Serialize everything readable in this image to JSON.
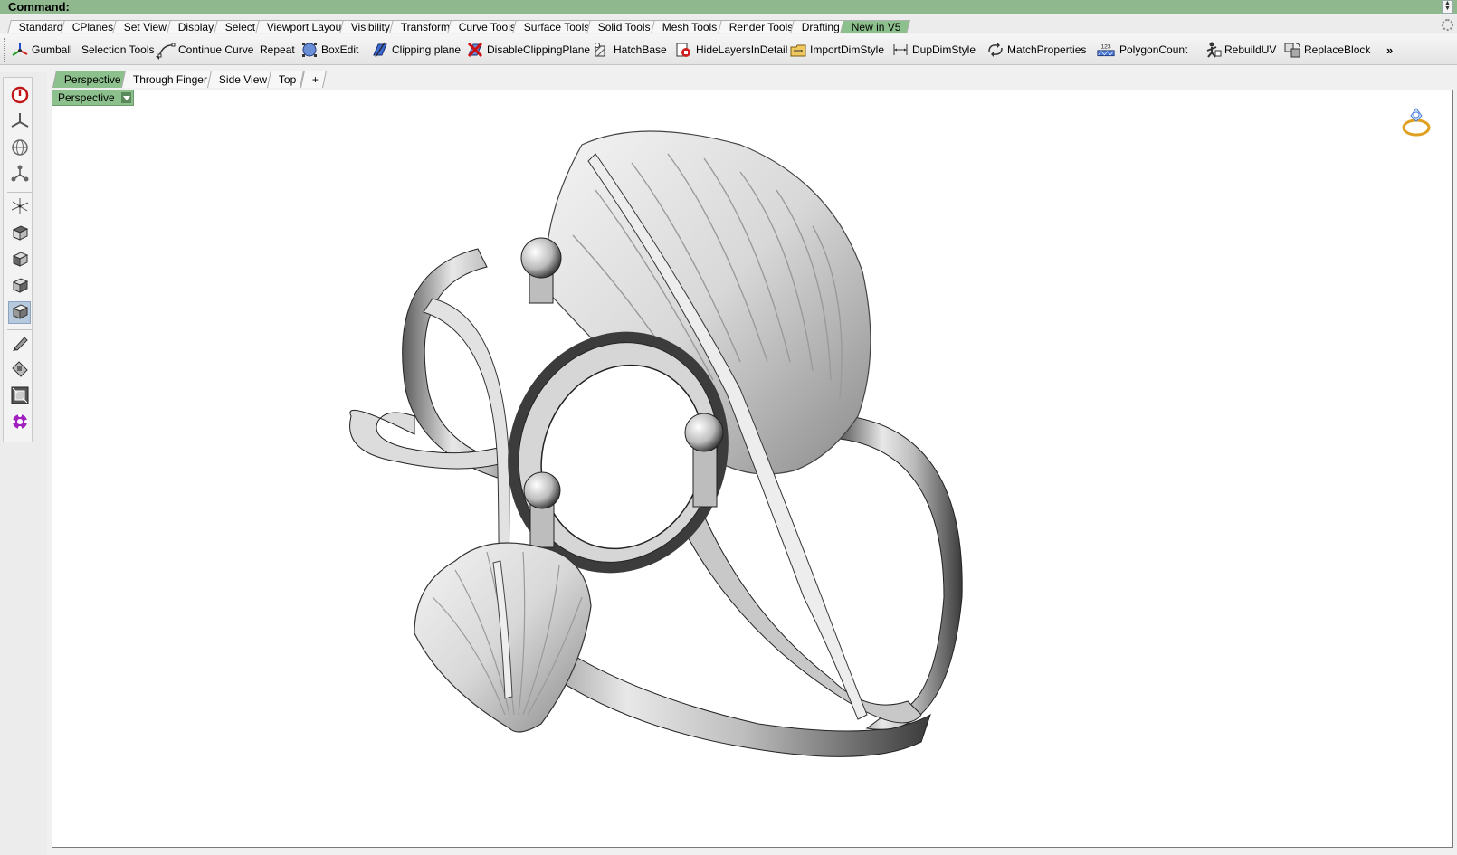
{
  "command": {
    "label": "Command:"
  },
  "toolbar_tabs": [
    {
      "label": "Standard",
      "active": false
    },
    {
      "label": "CPlanes",
      "active": false
    },
    {
      "label": "Set View",
      "active": false
    },
    {
      "label": "Display",
      "active": false
    },
    {
      "label": "Select",
      "active": false
    },
    {
      "label": "Viewport Layout",
      "active": false
    },
    {
      "label": "Visibility",
      "active": false
    },
    {
      "label": "Transform",
      "active": false
    },
    {
      "label": "Curve Tools",
      "active": false
    },
    {
      "label": "Surface Tools",
      "active": false
    },
    {
      "label": "Solid Tools",
      "active": false
    },
    {
      "label": "Mesh Tools",
      "active": false
    },
    {
      "label": "Render Tools",
      "active": false
    },
    {
      "label": "Drafting",
      "active": false
    },
    {
      "label": "New in V5",
      "active": true
    }
  ],
  "commands": [
    {
      "label": "Gumball",
      "icon": "gumball-icon"
    },
    {
      "label": "Selection Tools",
      "icon": "",
      "dropdown": true
    },
    {
      "label": "Continue Curve",
      "icon": "continue-curve-icon"
    },
    {
      "label": "Repeat",
      "icon": ""
    },
    {
      "label": "BoxEdit",
      "icon": "box-edit-icon"
    },
    {
      "label": "Clipping plane",
      "icon": "clipping-plane-icon"
    },
    {
      "label": "DisableClippingPlane",
      "icon": "disable-clipping-plane-icon"
    },
    {
      "label": "HatchBase",
      "icon": "hatch-base-icon"
    },
    {
      "label": "HideLayersInDetail",
      "icon": "hide-layers-icon"
    },
    {
      "label": "ImportDimStyle",
      "icon": "import-dim-style-icon"
    },
    {
      "label": "DupDimStyle",
      "icon": "dup-dim-style-icon"
    },
    {
      "label": "MatchProperties",
      "icon": "match-properties-icon"
    },
    {
      "label": "PolygonCount",
      "icon": "polygon-count-icon",
      "icon_text": "123"
    },
    {
      "label": "RebuildUV",
      "icon": "rebuild-uv-icon"
    },
    {
      "label": "ReplaceBlock",
      "icon": "replace-block-icon"
    }
  ],
  "more_label": "»",
  "left_tools": [
    "power-icon",
    "gumball-axes-icon",
    "globe-icon",
    "network-icon",
    "axes-icon",
    "box-top-icon",
    "box-front-icon",
    "box-right-icon",
    "box-perspective-icon",
    "pen-icon",
    "paint-icon",
    "zoom-extents-icon",
    "gear-flower-icon"
  ],
  "viewport_tabs": [
    {
      "label": "Perspective",
      "active": true
    },
    {
      "label": "Through Finger",
      "active": false
    },
    {
      "label": "Side View",
      "active": false
    },
    {
      "label": "Top",
      "active": false
    },
    {
      "label": "+",
      "active": false
    }
  ],
  "viewport": {
    "label": "Perspective"
  },
  "colors": {
    "accent_green": "#8cc08c",
    "command_bar": "#8fb88f"
  }
}
